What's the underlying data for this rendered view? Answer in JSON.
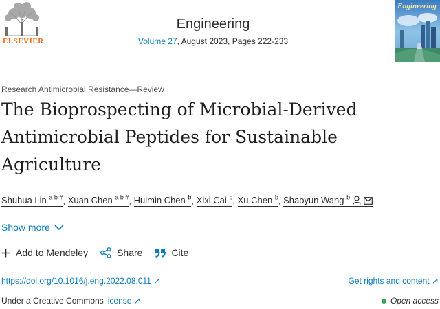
{
  "header": {
    "publisher": "ELSEVIER",
    "journal_title": "Engineering",
    "volume": "Volume 27",
    "meta_rest": ", August 2023, Pages 222-233",
    "cover_label": "Engineering"
  },
  "article": {
    "type": "Research Antimicrobial Resistance—Review",
    "title_lines": [
      "The Bioprospecting of Microbial-Derived",
      "Antimicrobial Peptides for Sustainable",
      "Agriculture"
    ]
  },
  "authors": [
    {
      "name": "Shuhua Lin",
      "sup": "a b #"
    },
    {
      "name": "Xuan Chen",
      "sup": "a b #"
    },
    {
      "name": "Huimin Chen",
      "sup": "b"
    },
    {
      "name": "Xixi Cai",
      "sup": "b"
    },
    {
      "name": "Xu Chen",
      "sup": "b"
    },
    {
      "name": "Shaoyun Wang",
      "sup": "b"
    }
  ],
  "show_more": "Show more",
  "actions": {
    "mendeley": "Add to Mendeley",
    "share": "Share",
    "cite": "Cite"
  },
  "links": {
    "doi": "https://doi.org/10.1016/j.eng.2022.08.011",
    "rights": "Get rights and content",
    "license_prefix": "Under a Creative Commons ",
    "license_link": "license",
    "open_access": "Open access"
  },
  "colors": {
    "link": "#0c7dbb",
    "publisher": "#e9711c",
    "open_access_dot": "#3aa44a"
  }
}
